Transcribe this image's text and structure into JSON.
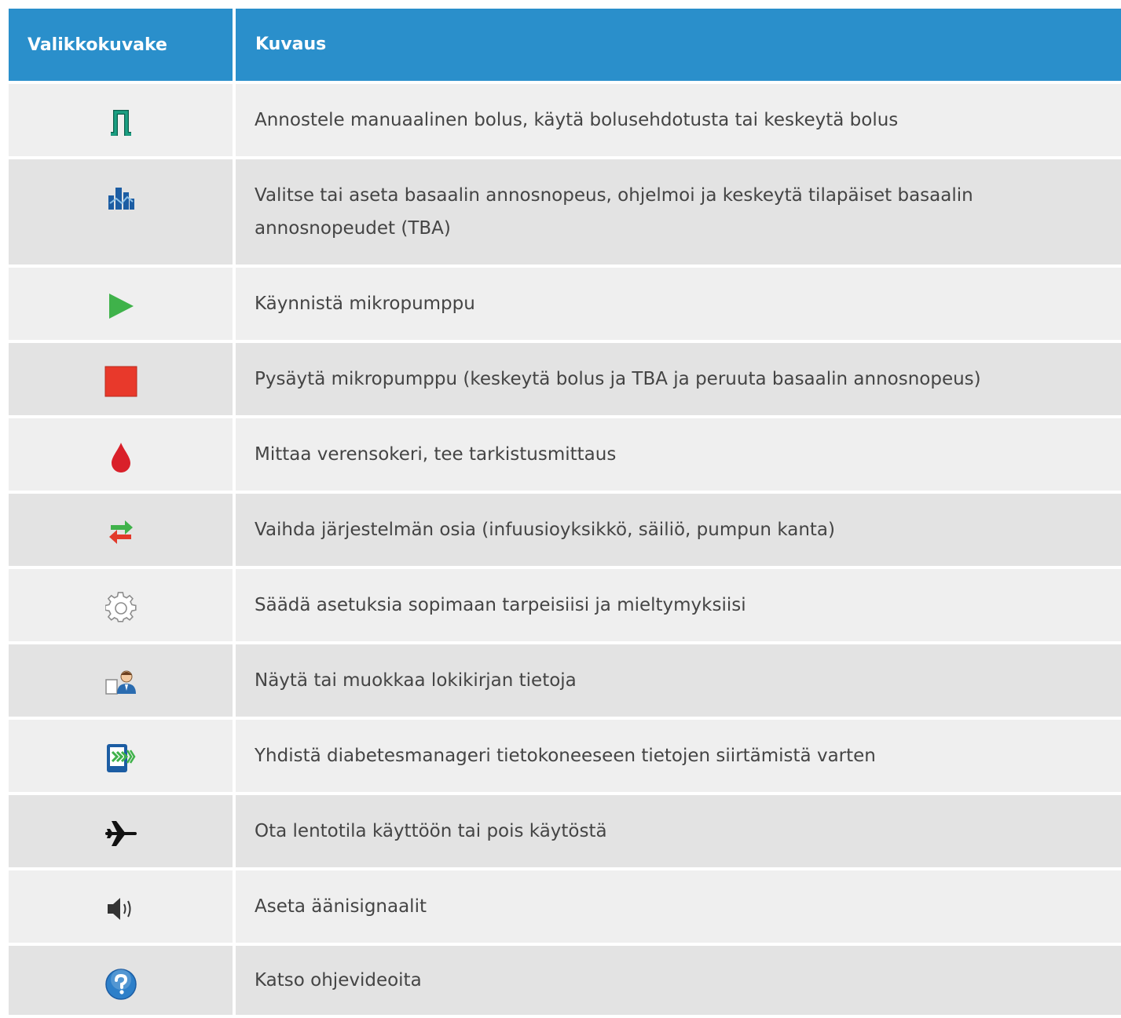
{
  "header": {
    "icon_column": "Valikkokuvake",
    "description_column": "Kuvaus"
  },
  "rows": [
    {
      "icon": "bolus-icon",
      "color": "#1ba083",
      "description": "Annostele manuaalinen bolus, käytä bolusehdotusta tai keskeytä bolus"
    },
    {
      "icon": "basal-rate-icon",
      "color": "#1c5da3",
      "description": "Valitse tai aseta basaalin annosnopeus, ohjelmoi ja keskeytä tilapäiset basaalin annosnopeudet (TBA)"
    },
    {
      "icon": "play-icon",
      "color": "#3fb24a",
      "description": "Käynnistä mikropumppu"
    },
    {
      "icon": "stop-icon",
      "color": "#e8392b",
      "description": "Pysäytä mikropumppu (keskeytä bolus ja TBA ja peruuta basaalin annosnopeus)"
    },
    {
      "icon": "blood-drop-icon",
      "color": "#d9202a",
      "description": "Mittaa verensokeri, tee tarkistusmittaus"
    },
    {
      "icon": "swap-arrows-icon",
      "color": "#3fb24a",
      "description": "Vaihda järjestelmän osia (infuusioyksikkö, säiliö, pumpun kanta)"
    },
    {
      "icon": "gear-icon",
      "color": "#8c8c8c",
      "description": "Säädä asetuksia sopimaan tarpeisiisi ja mieltymyksiisi"
    },
    {
      "icon": "logbook-person-icon",
      "color": "#2b6cb0",
      "description": "Näytä tai muokkaa lokikirjan tietoja"
    },
    {
      "icon": "device-transfer-icon",
      "color": "#1c5da3",
      "description": "Yhdistä diabetesmanageri tietokoneeseen tietojen siirtämistä varten"
    },
    {
      "icon": "airplane-icon",
      "color": "#111111",
      "description": "Ota lentotila käyttöön tai pois käytöstä"
    },
    {
      "icon": "speaker-icon",
      "color": "#333333",
      "description": "Aseta äänisignaalit"
    },
    {
      "icon": "help-icon",
      "color": "#2d7fc9",
      "description": "Katso ohjevideoita"
    }
  ]
}
